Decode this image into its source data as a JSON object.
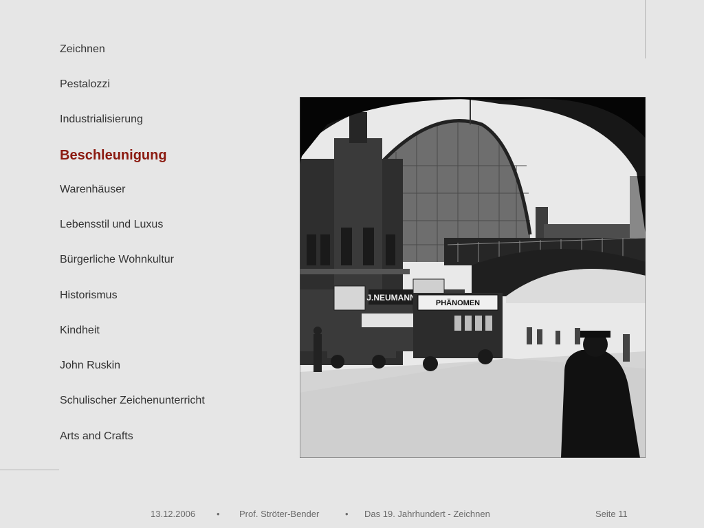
{
  "nav": {
    "items": [
      {
        "label": "Zeichnen",
        "active": false
      },
      {
        "label": "Pestalozzi",
        "active": false
      },
      {
        "label": "Industrialisierung",
        "active": false
      },
      {
        "label": "Beschleunigung",
        "active": true
      },
      {
        "label": "Warenhäuser",
        "active": false
      },
      {
        "label": "Lebensstil und Luxus",
        "active": false
      },
      {
        "label": "Bürgerliche Wohnkultur",
        "active": false
      },
      {
        "label": "Historismus",
        "active": false
      },
      {
        "label": "Kindheit",
        "active": false
      },
      {
        "label": "John Ruskin",
        "active": false
      },
      {
        "label": "Schulischer Zeichenunterricht",
        "active": false
      },
      {
        "label": "Arts and Crafts",
        "active": false
      }
    ]
  },
  "photo": {
    "signs": {
      "neumann": "J.NEUMANN",
      "phanomen": "PHÄNOMEN"
    }
  },
  "footer": {
    "date": "13.12.2006",
    "separator": "•",
    "author": "Prof. Ströter-Bender",
    "title": "Das 19. Jahrhundert - Zeichnen",
    "page": "Seite 11"
  },
  "colors": {
    "background": "#e6e6e6",
    "nav_text": "#333333",
    "active_text": "#8b1a10",
    "footer_text": "#6a6a6a",
    "rule": "#b4b4b4"
  }
}
